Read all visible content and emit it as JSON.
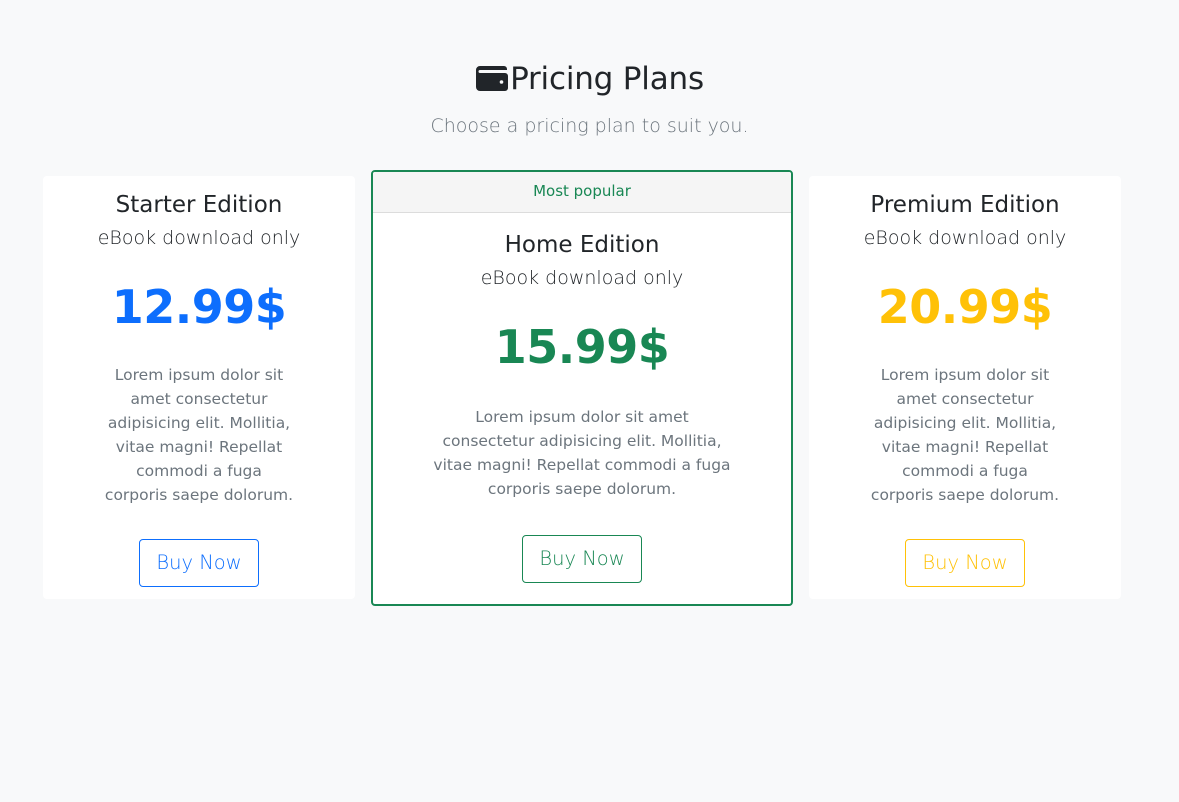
{
  "header": {
    "icon": "wallet-icon",
    "title": "Pricing Plans",
    "subtitle": "Choose a pricing plan to suit you."
  },
  "plans": [
    {
      "name": "Starter Edition",
      "subtitle": "eBook download only",
      "price": "12.99$",
      "description": "Lorem ipsum dolor sit amet consectetur adipisicing elit. Mollitia, vitae magni! Repellat commodi a fuga corporis saepe dolorum.",
      "button": "Buy Now",
      "color": "#0d6efd"
    },
    {
      "badge": "Most popular",
      "name": "Home Edition",
      "subtitle": "eBook download only",
      "price": "15.99$",
      "description": "Lorem ipsum dolor sit amet consectetur adipisicing elit. Mollitia, vitae magni! Repellat commodi a fuga corporis saepe dolorum.",
      "button": "Buy Now",
      "color": "#198754"
    },
    {
      "name": "Premium Edition",
      "subtitle": "eBook download only",
      "price": "20.99$",
      "description": "Lorem ipsum dolor sit amet consectetur adipisicing elit. Mollitia, vitae magni! Repellat commodi a fuga corporis saepe dolorum.",
      "button": "Buy Now",
      "color": "#ffc107"
    }
  ]
}
